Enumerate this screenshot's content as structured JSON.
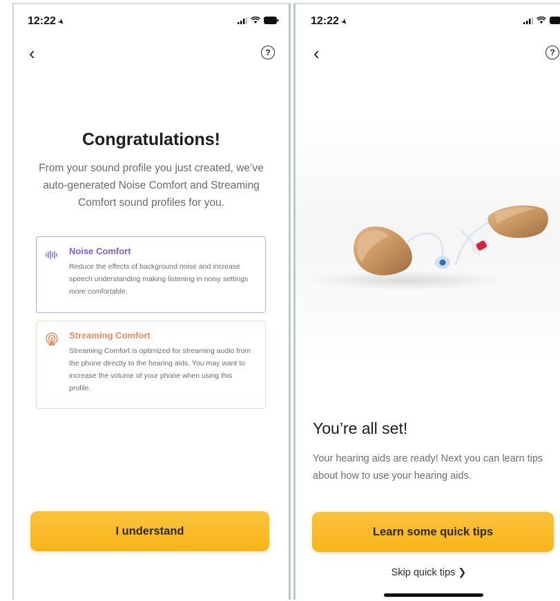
{
  "left_screen": {
    "status": {
      "time": "12:22"
    },
    "title": "Congratulations!",
    "subtitle": "From your sound profile you just created, we’ve auto-generated Noise Comfort and Streaming Comfort sound profiles for you.",
    "cards": [
      {
        "title": "Noise Comfort",
        "body": "Reduce the effects of background noise and increase speech understanding making listening in noisy settings more comfortable.",
        "icon": "sound-wave-icon",
        "color": "#7c5ee0"
      },
      {
        "title": "Streaming Comfort",
        "body": "Streaming Comfort is optimized for streaming audio from the phone directly to the hearing aids. You may want to increase the volume of your phone when using this profile.",
        "icon": "streaming-icon",
        "color": "#f08a5a"
      }
    ],
    "button": "I understand"
  },
  "right_screen": {
    "status": {
      "time": "12:22"
    },
    "title": "You’re all set!",
    "subtitle": "Your hearing aids are ready! Next you can learn tips about how to use your hearing aids.",
    "button": "Learn some quick tips",
    "skip_link": "Skip quick tips"
  },
  "colors": {
    "accent": "#f8ba22",
    "noise": "#7c5ee0",
    "streaming": "#f08a5a"
  }
}
